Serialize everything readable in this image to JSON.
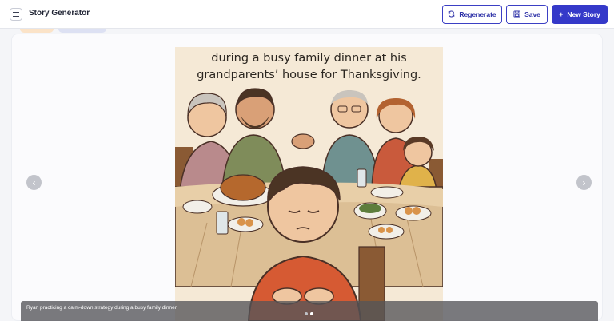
{
  "header": {
    "title": "Story Generator",
    "regenerate_label": "Regenerate",
    "save_label": "Save",
    "new_story_label": "New Story"
  },
  "illustration": {
    "caption_line1": "during a busy family dinner at his",
    "caption_line2": "grandparents’ house for Thanksgiving."
  },
  "slide": {
    "caption": "Ryan practicing a calm-down strategy during a busy family dinner."
  },
  "pagination": {
    "current": 2,
    "total": 2
  },
  "icons": {
    "menu": "menu-icon",
    "regenerate": "refresh-icon",
    "save": "save-icon",
    "new_story": "plus-icon",
    "prev": "chevron-left-icon",
    "next": "chevron-right-icon"
  },
  "colors": {
    "accent": "#3539c9",
    "illustration_bg": "#f5e9d6"
  }
}
